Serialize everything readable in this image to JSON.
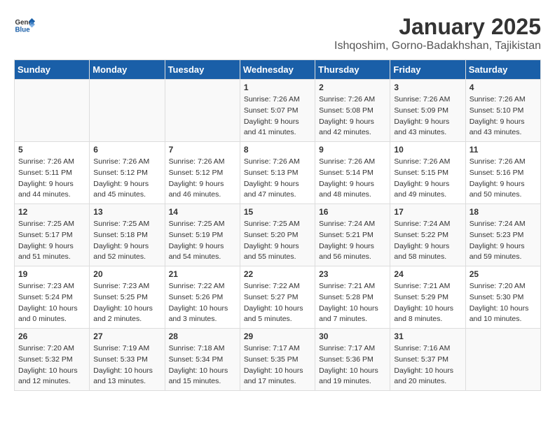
{
  "header": {
    "logo_line1": "General",
    "logo_line2": "Blue",
    "title": "January 2025",
    "subtitle": "Ishqoshim, Gorno-Badakhshan, Tajikistan"
  },
  "calendar": {
    "days_of_week": [
      "Sunday",
      "Monday",
      "Tuesday",
      "Wednesday",
      "Thursday",
      "Friday",
      "Saturday"
    ],
    "weeks": [
      [
        {
          "num": "",
          "info": ""
        },
        {
          "num": "",
          "info": ""
        },
        {
          "num": "",
          "info": ""
        },
        {
          "num": "1",
          "info": "Sunrise: 7:26 AM\nSunset: 5:07 PM\nDaylight: 9 hours and 41 minutes."
        },
        {
          "num": "2",
          "info": "Sunrise: 7:26 AM\nSunset: 5:08 PM\nDaylight: 9 hours and 42 minutes."
        },
        {
          "num": "3",
          "info": "Sunrise: 7:26 AM\nSunset: 5:09 PM\nDaylight: 9 hours and 43 minutes."
        },
        {
          "num": "4",
          "info": "Sunrise: 7:26 AM\nSunset: 5:10 PM\nDaylight: 9 hours and 43 minutes."
        }
      ],
      [
        {
          "num": "5",
          "info": "Sunrise: 7:26 AM\nSunset: 5:11 PM\nDaylight: 9 hours and 44 minutes."
        },
        {
          "num": "6",
          "info": "Sunrise: 7:26 AM\nSunset: 5:12 PM\nDaylight: 9 hours and 45 minutes."
        },
        {
          "num": "7",
          "info": "Sunrise: 7:26 AM\nSunset: 5:12 PM\nDaylight: 9 hours and 46 minutes."
        },
        {
          "num": "8",
          "info": "Sunrise: 7:26 AM\nSunset: 5:13 PM\nDaylight: 9 hours and 47 minutes."
        },
        {
          "num": "9",
          "info": "Sunrise: 7:26 AM\nSunset: 5:14 PM\nDaylight: 9 hours and 48 minutes."
        },
        {
          "num": "10",
          "info": "Sunrise: 7:26 AM\nSunset: 5:15 PM\nDaylight: 9 hours and 49 minutes."
        },
        {
          "num": "11",
          "info": "Sunrise: 7:26 AM\nSunset: 5:16 PM\nDaylight: 9 hours and 50 minutes."
        }
      ],
      [
        {
          "num": "12",
          "info": "Sunrise: 7:25 AM\nSunset: 5:17 PM\nDaylight: 9 hours and 51 minutes."
        },
        {
          "num": "13",
          "info": "Sunrise: 7:25 AM\nSunset: 5:18 PM\nDaylight: 9 hours and 52 minutes."
        },
        {
          "num": "14",
          "info": "Sunrise: 7:25 AM\nSunset: 5:19 PM\nDaylight: 9 hours and 54 minutes."
        },
        {
          "num": "15",
          "info": "Sunrise: 7:25 AM\nSunset: 5:20 PM\nDaylight: 9 hours and 55 minutes."
        },
        {
          "num": "16",
          "info": "Sunrise: 7:24 AM\nSunset: 5:21 PM\nDaylight: 9 hours and 56 minutes."
        },
        {
          "num": "17",
          "info": "Sunrise: 7:24 AM\nSunset: 5:22 PM\nDaylight: 9 hours and 58 minutes."
        },
        {
          "num": "18",
          "info": "Sunrise: 7:24 AM\nSunset: 5:23 PM\nDaylight: 9 hours and 59 minutes."
        }
      ],
      [
        {
          "num": "19",
          "info": "Sunrise: 7:23 AM\nSunset: 5:24 PM\nDaylight: 10 hours and 0 minutes."
        },
        {
          "num": "20",
          "info": "Sunrise: 7:23 AM\nSunset: 5:25 PM\nDaylight: 10 hours and 2 minutes."
        },
        {
          "num": "21",
          "info": "Sunrise: 7:22 AM\nSunset: 5:26 PM\nDaylight: 10 hours and 3 minutes."
        },
        {
          "num": "22",
          "info": "Sunrise: 7:22 AM\nSunset: 5:27 PM\nDaylight: 10 hours and 5 minutes."
        },
        {
          "num": "23",
          "info": "Sunrise: 7:21 AM\nSunset: 5:28 PM\nDaylight: 10 hours and 7 minutes."
        },
        {
          "num": "24",
          "info": "Sunrise: 7:21 AM\nSunset: 5:29 PM\nDaylight: 10 hours and 8 minutes."
        },
        {
          "num": "25",
          "info": "Sunrise: 7:20 AM\nSunset: 5:30 PM\nDaylight: 10 hours and 10 minutes."
        }
      ],
      [
        {
          "num": "26",
          "info": "Sunrise: 7:20 AM\nSunset: 5:32 PM\nDaylight: 10 hours and 12 minutes."
        },
        {
          "num": "27",
          "info": "Sunrise: 7:19 AM\nSunset: 5:33 PM\nDaylight: 10 hours and 13 minutes."
        },
        {
          "num": "28",
          "info": "Sunrise: 7:18 AM\nSunset: 5:34 PM\nDaylight: 10 hours and 15 minutes."
        },
        {
          "num": "29",
          "info": "Sunrise: 7:17 AM\nSunset: 5:35 PM\nDaylight: 10 hours and 17 minutes."
        },
        {
          "num": "30",
          "info": "Sunrise: 7:17 AM\nSunset: 5:36 PM\nDaylight: 10 hours and 19 minutes."
        },
        {
          "num": "31",
          "info": "Sunrise: 7:16 AM\nSunset: 5:37 PM\nDaylight: 10 hours and 20 minutes."
        },
        {
          "num": "",
          "info": ""
        }
      ]
    ]
  }
}
